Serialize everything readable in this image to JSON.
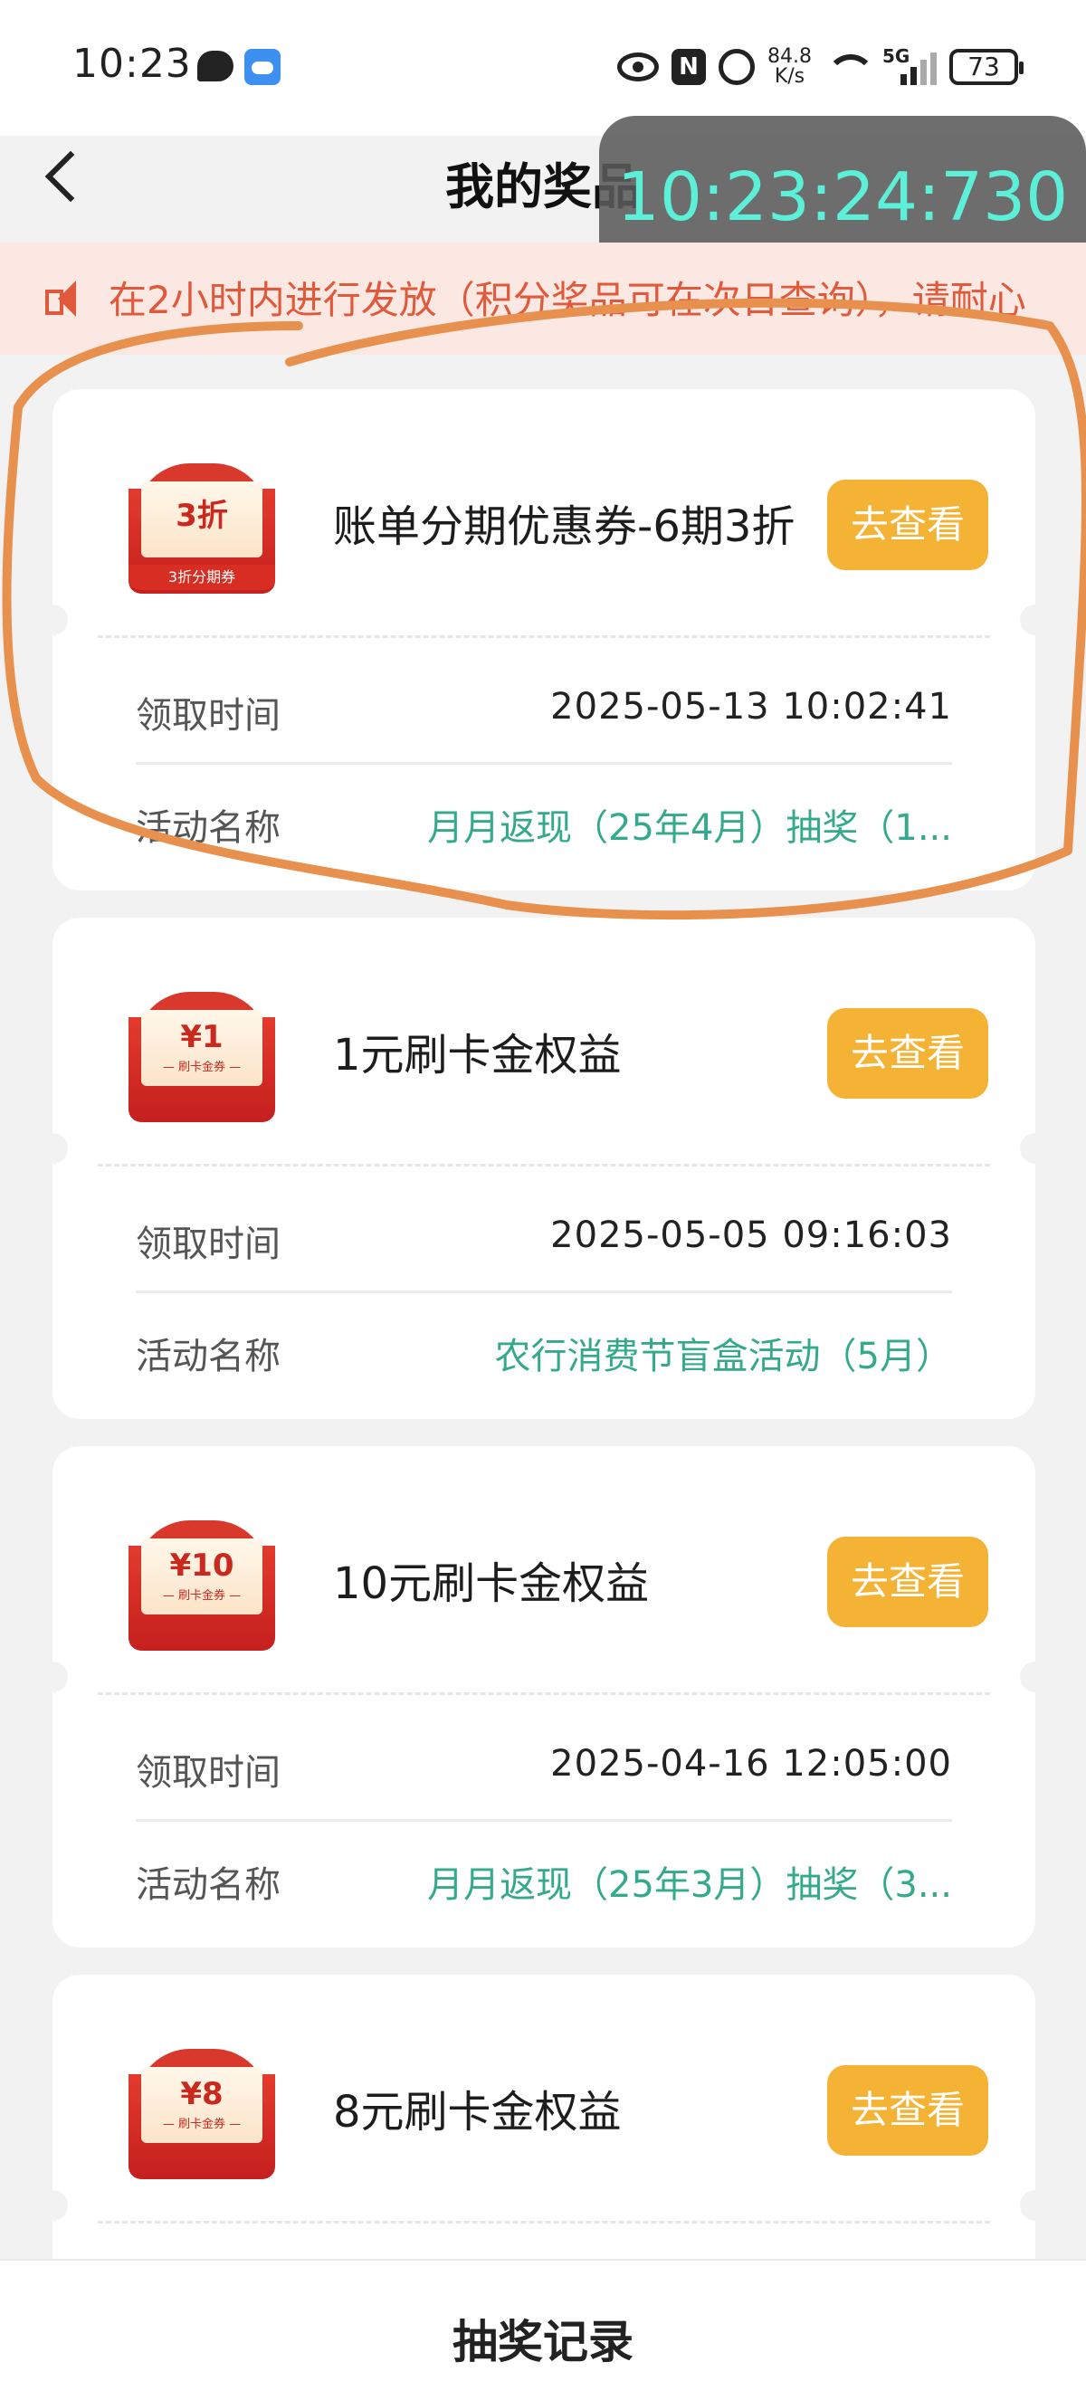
{
  "status_bar": {
    "time": "10:23",
    "net_speed_value": "84.8",
    "net_speed_unit": "K/s",
    "network": "5G",
    "battery": "73"
  },
  "header": {
    "title": "我的奖品"
  },
  "clock_overlay": {
    "time": "10:23:24:730"
  },
  "notice": {
    "text": "在2小时内进行发放（积分奖品可在次日查询），请耐心"
  },
  "labels": {
    "receive_time": "领取时间",
    "activity_name": "活动名称",
    "view_button": "去查看"
  },
  "prizes": [
    {
      "title": "账单分期优惠券-6期3折",
      "coupon_big": "3折",
      "coupon_band": "3折分期券",
      "receive_time": "2025-05-13 10:02:41",
      "activity": "月月返现（25年4月）抽奖（1..."
    },
    {
      "title": "1元刷卡金权益",
      "coupon_big": "¥1",
      "coupon_small": "— 刷卡金券 —",
      "receive_time": "2025-05-05 09:16:03",
      "activity": "农行消费节盲盒活动（5月）"
    },
    {
      "title": "10元刷卡金权益",
      "coupon_big": "¥10",
      "coupon_small": "— 刷卡金券 —",
      "receive_time": "2025-04-16 12:05:00",
      "activity": "月月返现（25年3月）抽奖（3..."
    },
    {
      "title": "8元刷卡金权益",
      "coupon_big": "¥8",
      "coupon_small": "— 刷卡金券 —",
      "receive_time": "",
      "activity": ""
    }
  ],
  "bottom_bar": {
    "label": "抽奖记录"
  },
  "colors": {
    "accent_button": "#f5b335",
    "activity_text": "#35a98b",
    "notice_text": "#e0593b",
    "highlight_stroke": "#e8914f"
  }
}
